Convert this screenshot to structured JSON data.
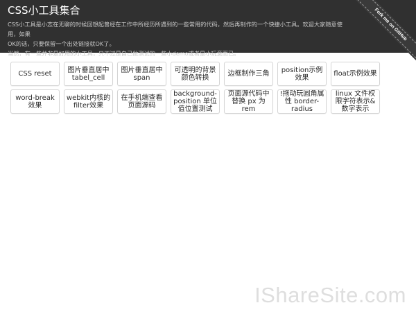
{
  "header": {
    "title": "CSS小工具集合",
    "description_lines": [
      "CSS小工具是小志在无聊的时候回想起曾经在工作中所经历所遇到的一些常用的代码，然后再制作的一个快捷小工具。欢迎大家随意使用，如果",
      "OK的话，只要保留一个出处链接就OK了。",
      "当然，有一些并非是好用的小工具，只不过是自己做测试的一些小demo或者是小玩意而已。"
    ],
    "ribbon_label": "Fork me on GitHub"
  },
  "tools": {
    "row1": [
      "CSS reset",
      "图片垂直居中tabel_cell",
      "图片垂直居中span",
      "可透明的背景颜色转换",
      "边框制作三角",
      "position示例效果",
      "float示例效果"
    ],
    "row2": [
      "word-break效果",
      "webkit内核的filter效果",
      "在手机端查看页面源码",
      "background-position 单位值位置测试",
      "页面源代码中替换 px 为 rem",
      "!拖动玩圆角属性 border-radius",
      "linux 文件权限字符表示&数字表示"
    ]
  },
  "watermark": "IShareSite.com",
  "colors": {
    "header_bg": "#303030",
    "button_border": "#d4d4d4",
    "ribbon_bg": "#3a3a3a"
  }
}
